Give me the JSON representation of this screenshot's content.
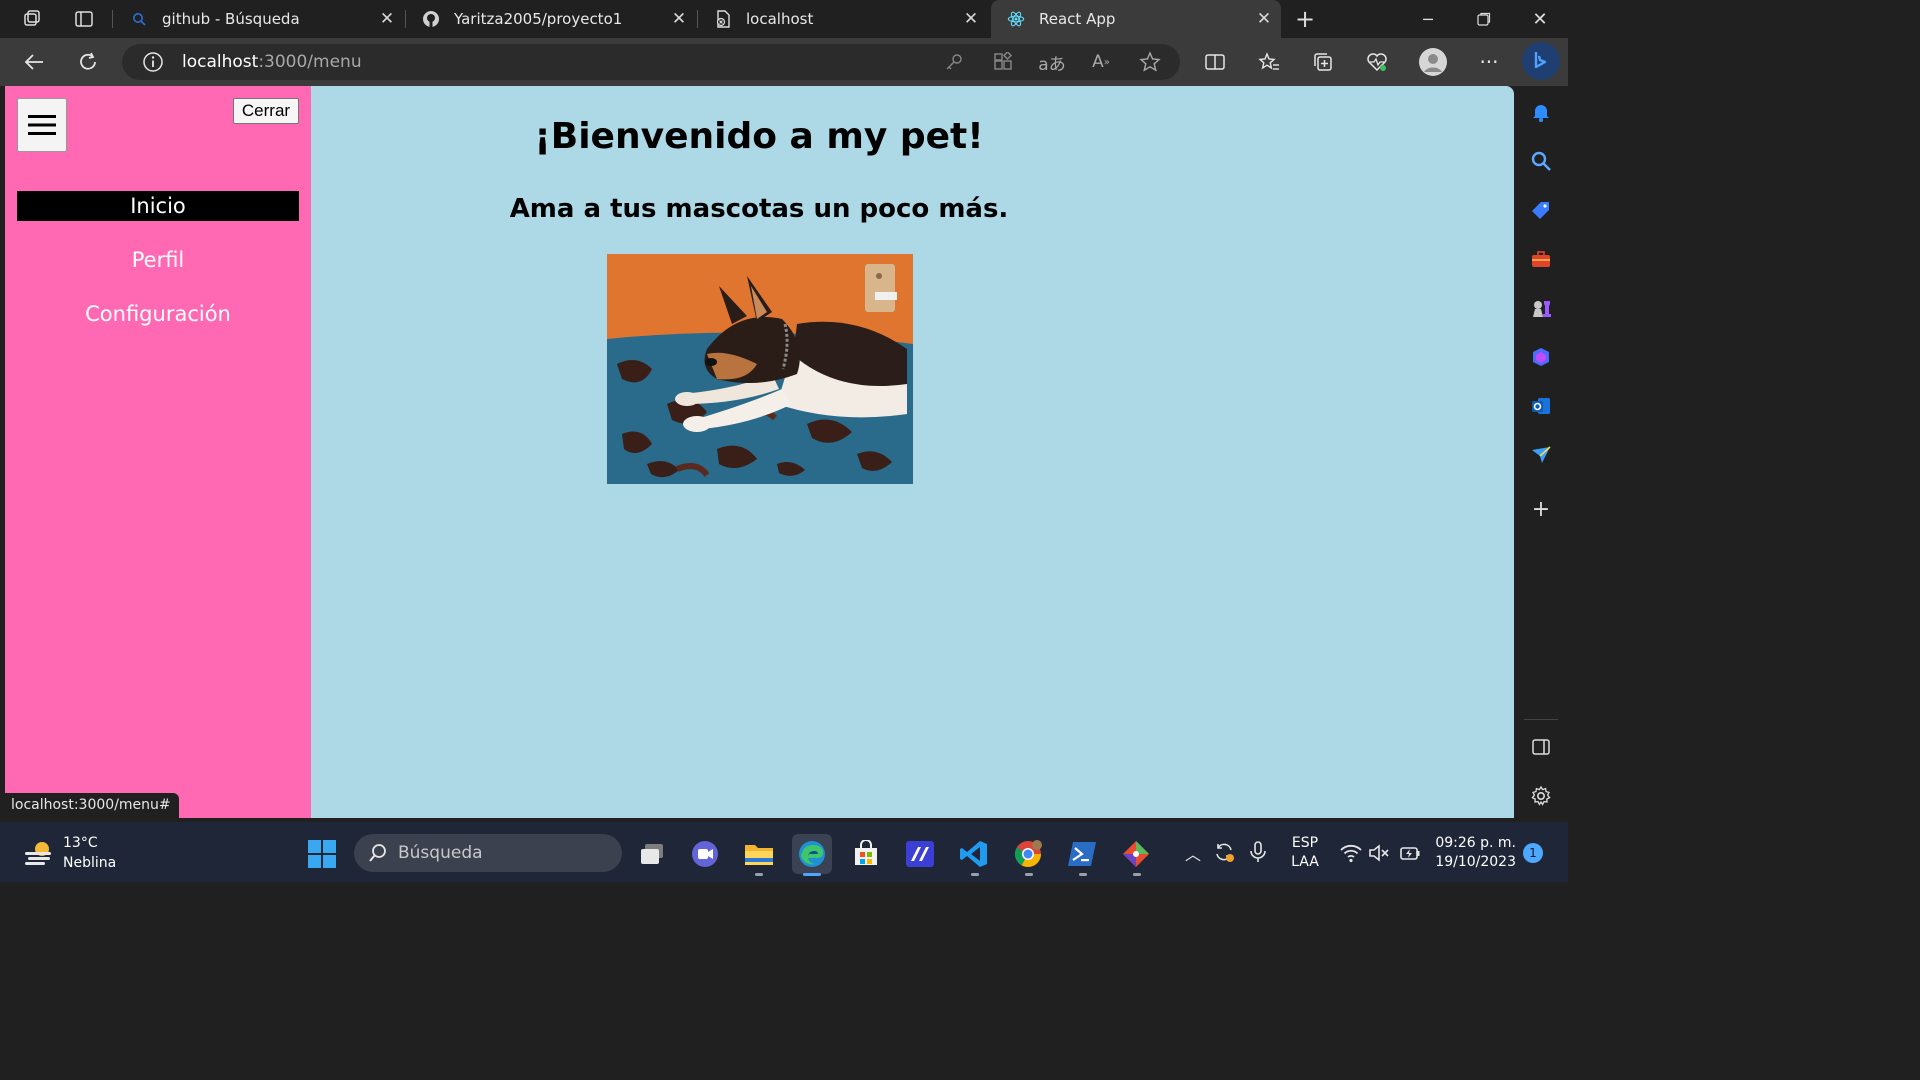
{
  "browser": {
    "tabs": [
      {
        "label": "github - Búsqueda",
        "icon": "search-icon",
        "active": false
      },
      {
        "label": "Yaritza2005/proyecto1",
        "icon": "github-icon",
        "active": false
      },
      {
        "label": "localhost",
        "icon": "page-error-icon",
        "active": false
      },
      {
        "label": "React App",
        "icon": "react-icon",
        "active": true
      }
    ],
    "url_host": "localhost",
    "url_path": ":3000/menu",
    "status_link": "localhost:3000/menu#"
  },
  "page": {
    "sidebar": {
      "close_label": "Cerrar",
      "menu_items": [
        {
          "label": "Inicio",
          "active": true
        },
        {
          "label": "Perfil",
          "active": false
        },
        {
          "label": "Configuración",
          "active": false
        }
      ]
    },
    "title": "¡Bienvenido a my pet!",
    "subtitle": "Ama a tus mascotas un poco más."
  },
  "taskbar": {
    "weather_temp": "13°C",
    "weather_desc": "Neblina",
    "search_placeholder": "Búsqueda",
    "lang": "ESP",
    "lang_sub": "LAA",
    "time": "09:26 p. m.",
    "date": "19/10/2023",
    "notifications": "1"
  },
  "colors": {
    "sidebar_bg": "#ff69b4",
    "page_bg": "#add8e6",
    "active_item_bg": "#000000"
  }
}
